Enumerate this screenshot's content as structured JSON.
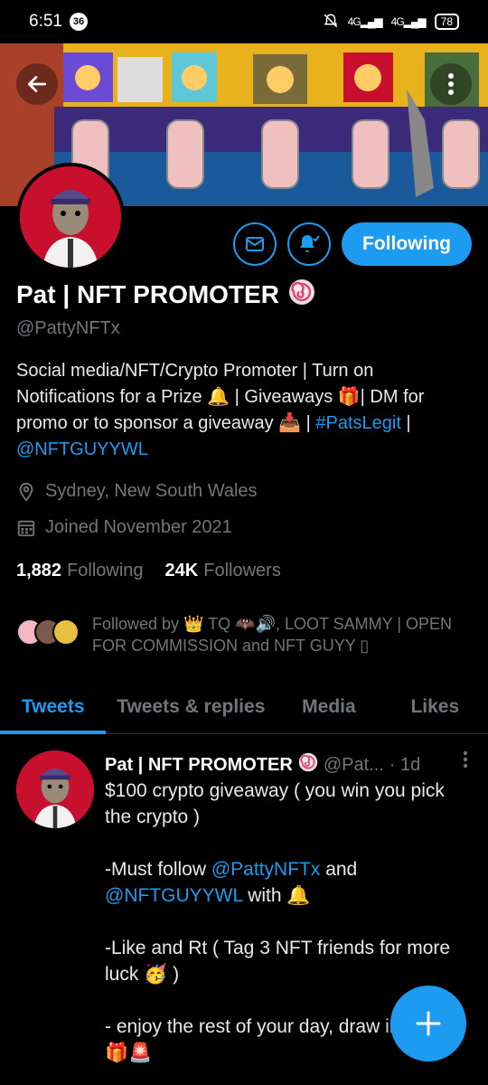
{
  "status_bar": {
    "time": "6:51",
    "notif_count": "36",
    "battery": "78",
    "signal1": "4G",
    "signal2": "4G"
  },
  "profile": {
    "name": "Pat | NFT PROMOTER",
    "handle": "@PattyNFTx",
    "bio_line1": "Social media/NFT/Crypto Promoter | Turn on Notifications for a Prize 🔔 | Giveaways 🎁| DM for promo or to sponsor a giveaway 📥 | ",
    "bio_hashtag": "#PatsLegit",
    "bio_sep": " |",
    "bio_mention": "@NFTGUYYWL",
    "location": "Sydney, New South Wales",
    "joined": "Joined November 2021",
    "following_count": "1,882",
    "following_label": "Following",
    "followers_count": "24K",
    "followers_label": "Followers",
    "followed_by": "Followed by 👑 TQ 🦇🔊, LOOT SAMMY | OPEN FOR COMMISSION and NFT GUYY ▯"
  },
  "actions": {
    "follow_label": "Following"
  },
  "tabs": [
    {
      "label": "Tweets",
      "active": true
    },
    {
      "label": "Tweets & replies",
      "active": false
    },
    {
      "label": "Media",
      "active": false
    },
    {
      "label": "Likes",
      "active": false
    }
  ],
  "tweet": {
    "name": "Pat | NFT PROMOTER",
    "handle": "@Pat...",
    "time": "· 1d",
    "line1": "$100 crypto giveaway ( you win you pick the crypto )",
    "line2_pre": "-Must follow ",
    "line2_m1": "@PattyNFTx",
    "line2_mid": " and ",
    "line2_m2": "@NFTGUYYWL",
    "line2_post": " with 🔔",
    "line3": "-Like and Rt ( Tag 3 NFT friends for more luck 🥳 )",
    "line4": "- enjoy the rest of your day, draw in 48 hrs 🎁🚨"
  },
  "colors": {
    "accent": "#1d9bf0",
    "avatar_bg": "#c8102e"
  }
}
